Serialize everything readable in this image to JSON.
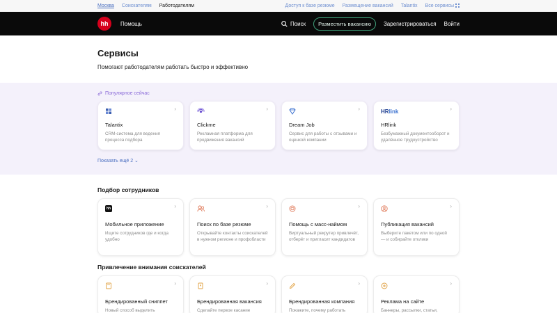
{
  "topbar": {
    "city": "Москва",
    "links_left": [
      "Соискателям",
      "Работодателям"
    ],
    "links_right": [
      "Доступ к базе резюме",
      "Размещение вакансий",
      "Talantix",
      "Все сервисы"
    ]
  },
  "header": {
    "logo": "hh",
    "help": "Помощь",
    "search": "Поиск",
    "post_vacancy": "Разместить вакансию",
    "register": "Зарегистрироваться",
    "login": "Войти"
  },
  "page": {
    "title": "Сервисы",
    "subtitle": "Помогают работодателям работать быстро и эффективно"
  },
  "popular": {
    "label": "Популярное сейчас",
    "show_more": "Показать ещё 2",
    "cards": [
      {
        "name": "Talantix",
        "desc": "CRM-система для ведения процесса подбора",
        "icon": "talantix-icon"
      },
      {
        "name": "Clickme",
        "desc": "Рекламная платформа для продвижения вакансий",
        "icon": "clickme-icon"
      },
      {
        "name": "Dream Job",
        "desc": "Сервис для работы с отзывами и оценкой компании",
        "icon": "dreamjob-icon"
      },
      {
        "name": "HRlink",
        "desc": "Безбумажный документооборот и удалённое трудоустройство",
        "icon": "hrlink-logo"
      }
    ]
  },
  "sections": [
    {
      "title": "Подбор сотрудников",
      "cards": [
        {
          "name": "Мобильное приложение",
          "desc": "Ищите сотрудников где и когда удобно",
          "icon": "hh-app-icon"
        },
        {
          "name": "Поиск по базе резюме",
          "desc": "Открывайте контакты соискателей в нужном регионе и профобласти",
          "icon": "people-icon"
        },
        {
          "name": "Помощь с масс-наймом",
          "desc": "Виртуальный рекрутер привлечёт, отберёт и пригласит кандидатов",
          "icon": "robot-icon"
        },
        {
          "name": "Публикация вакансий",
          "desc": "Выберите пакетом или по одной — и собирайте отклики",
          "icon": "person-icon"
        }
      ]
    },
    {
      "title": "Привлечение внимания соискателей",
      "cards": [
        {
          "name": "Брендированный сниппет",
          "desc": "Новый способ выделить",
          "icon": "snippet-icon"
        },
        {
          "name": "Брендированная вакансия",
          "desc": "Сделайте первое касание",
          "icon": "document-icon"
        },
        {
          "name": "Брендированная компания",
          "desc": "Покажите, почему работать",
          "icon": "pencil-icon"
        },
        {
          "name": "Реклама на сайте",
          "desc": "Баннеры, рассылки, статьи,",
          "icon": "plus-circle-icon"
        }
      ]
    }
  ]
}
